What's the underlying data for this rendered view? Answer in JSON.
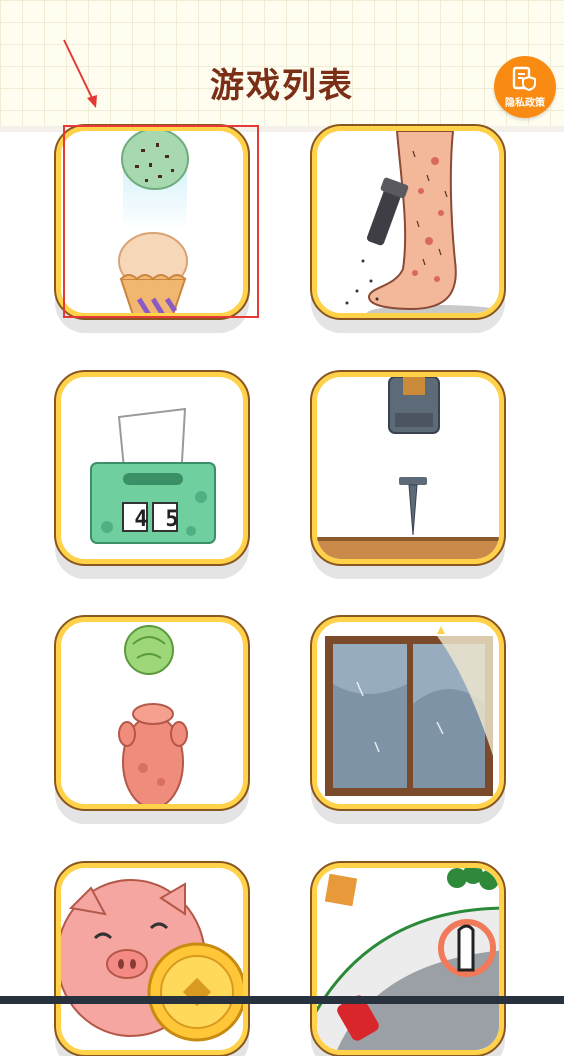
{
  "header": {
    "title": "游戏列表",
    "privacy_label": "隐私政策"
  },
  "games": [
    {
      "name": "ice-cream-stack"
    },
    {
      "name": "leg-shave"
    },
    {
      "name": "tissue-box",
      "counter": [
        "4",
        "5"
      ]
    },
    {
      "name": "nail-hammer"
    },
    {
      "name": "pig-cabbage"
    },
    {
      "name": "window-clean"
    },
    {
      "name": "pig-gold-coin"
    },
    {
      "name": "race-track"
    }
  ],
  "colors": {
    "title": "#7a2f16",
    "accent_orange": "#f98b12",
    "card_border": "#ffd24a",
    "annotation_red": "#e53935"
  }
}
